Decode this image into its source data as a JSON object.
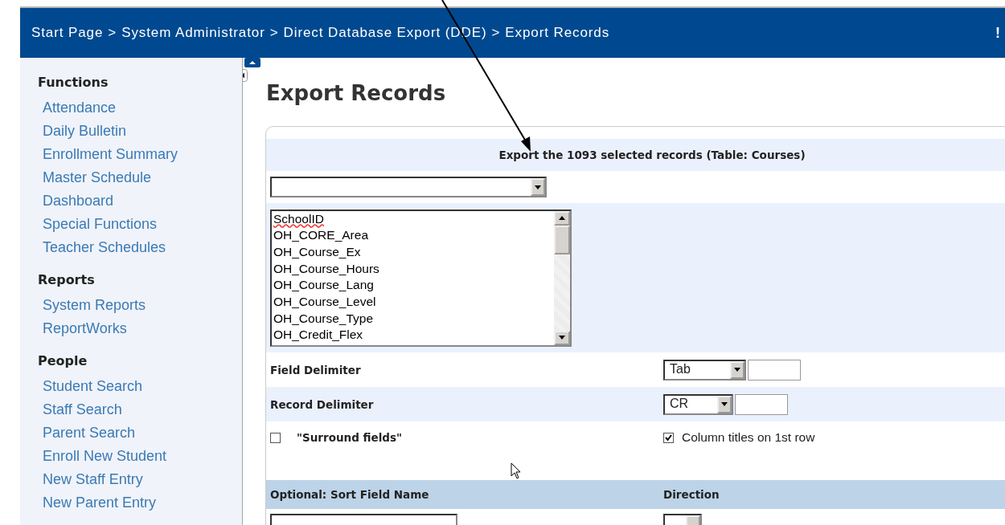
{
  "header": {
    "breadcrumb": [
      {
        "label": "Start Page",
        "separator": ">"
      },
      {
        "label": "System Administrator",
        "separator": ">"
      },
      {
        "label": "Direct Database Export (DDE)",
        "separator": ">"
      },
      {
        "label": "Export Records"
      }
    ],
    "alert": "!"
  },
  "sidebar": {
    "sections": [
      {
        "title": "Functions",
        "items": [
          "Attendance",
          "Daily Bulletin",
          "Enrollment Summary",
          "Master Schedule",
          "Dashboard",
          "Special Functions",
          "Teacher Schedules"
        ]
      },
      {
        "title": "Reports",
        "items": [
          "System Reports",
          "ReportWorks"
        ]
      },
      {
        "title": "People",
        "items": [
          "Student Search",
          "Staff Search",
          "Parent Search",
          "Enroll New Student",
          "New Staff Entry",
          "New Parent Entry"
        ]
      }
    ]
  },
  "page_title": "Export Records",
  "export_form": {
    "heading": "Export the 1093 selected records (Table: Courses)",
    "field_list": [
      {
        "name": "SchoolID",
        "misspelled": true
      },
      {
        "name": "OH_CORE_Area",
        "misspelled": false
      },
      {
        "name": "OH_Course_Ex",
        "misspelled": false
      },
      {
        "name": "OH_Course_Hours",
        "misspelled": false
      },
      {
        "name": "OH_Course_Lang",
        "misspelled": false
      },
      {
        "name": "OH_Course_Level",
        "misspelled": false
      },
      {
        "name": "OH_Course_Type",
        "misspelled": false
      },
      {
        "name": "OH_Credit_Flex",
        "misspelled": false
      }
    ],
    "field_delimiter": {
      "label": "Field Delimiter",
      "value": "Tab"
    },
    "record_delimiter": {
      "label": "Record Delimiter",
      "value": "CR"
    },
    "surround_fields": {
      "label": "\"Surround fields\"",
      "checked": false
    },
    "column_titles": {
      "label": "Column titles on 1st row",
      "checked": true
    },
    "sort_columns": [
      "Optional: Sort Field Name",
      "Direction"
    ]
  }
}
